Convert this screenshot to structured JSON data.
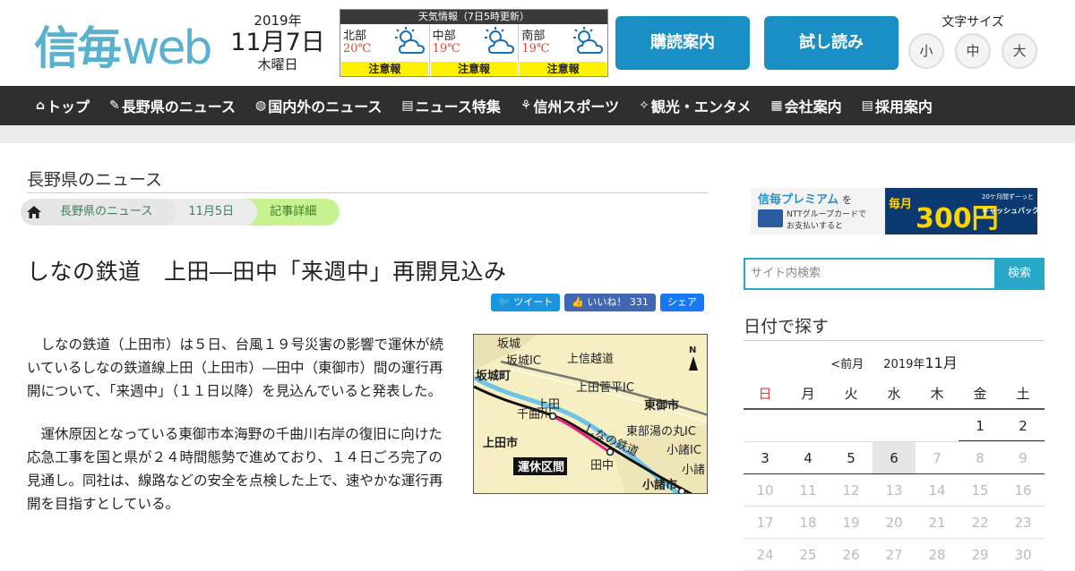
{
  "header": {
    "logo_kanji": "信毎",
    "logo_web": "web",
    "date_year": "2019年",
    "date_md": "11月7日",
    "date_weekday": "木曜日",
    "weather": {
      "title": "天気情報（7日5時更新）",
      "regions": [
        {
          "name": "北部",
          "temp": "20℃",
          "warning": "注意報",
          "icon": "sun-cloud-icon"
        },
        {
          "name": "中部",
          "temp": "19℃",
          "warning": "注意報",
          "icon": "sun-cloud-icon"
        },
        {
          "name": "南部",
          "temp": "19℃",
          "warning": "注意報",
          "icon": "sun-cloud-icon"
        }
      ]
    },
    "subscribe_label": "購読案内",
    "trial_label": "試し読み",
    "fontsize": {
      "label": "文字サイズ",
      "small": "小",
      "medium": "中",
      "large": "大"
    }
  },
  "nav": [
    {
      "icon": "home-icon",
      "glyph": "⌂",
      "label": "トップ"
    },
    {
      "icon": "bolt-icon",
      "glyph": "✎",
      "label": "長野県のニュース"
    },
    {
      "icon": "globe-icon",
      "glyph": "◍",
      "label": "国内外のニュース"
    },
    {
      "icon": "document-icon",
      "glyph": "▤",
      "label": "ニュース特集"
    },
    {
      "icon": "sports-icon",
      "glyph": "⚘",
      "label": "信州スポーツ"
    },
    {
      "icon": "camera-icon",
      "glyph": "✧",
      "label": "観光・エンタメ"
    },
    {
      "icon": "building-icon",
      "glyph": "▦",
      "label": "会社案内"
    },
    {
      "icon": "list-icon",
      "glyph": "▤",
      "label": "採用案内"
    }
  ],
  "article": {
    "category": "長野県のニュース",
    "breadcrumbs": [
      "長野県のニュース",
      "11月5日",
      "記事詳細"
    ],
    "headline": "しなの鉄道　上田―田中「来週中」再開見込み",
    "share": {
      "tweet": "ツイート",
      "like": "いいね！ 331",
      "share": "シェア"
    },
    "paragraphs": [
      "しなの鉄道（上田市）は５日、台風１９号災害の影響で運休が続いているしなの鉄道線上田（上田市）―田中（東御市）間の運行再開について、「来週中」（１１日以降）を見込んでいると発表した。",
      "運休原因となっている東御市本海野の千曲川右岸の復旧に向けた応急工事を国と県が２４時間態勢で進めており、１４日ごろ完了の見通し。同社は、線路などの安全を点検した上で、速やかな運行再開を目指すとしている。"
    ],
    "map_labels": {
      "sakaki": "坂城",
      "sakaki_ic": "坂城IC",
      "joshin": "上信越道",
      "sakaki_town": "坂城町",
      "ueda": "上田",
      "ueda_sugadaira": "上田菅平IC",
      "tomi": "東御市",
      "chikuma": "千曲川",
      "tobu": "東部湯の丸IC",
      "shinano": "しなの鉄道",
      "ueda_city": "上田市",
      "komoro_ic": "小諸IC",
      "suspended": "運休区間",
      "tanaka": "田中",
      "komoro": "小諸",
      "komoro_city": "小諸市",
      "north": "N"
    }
  },
  "sidebar": {
    "ad": {
      "brand": "信毎プレミアム",
      "suffix": "を",
      "line1": "NTTグループカードで",
      "line2": "お支払いすると",
      "maitsuki": "毎月",
      "amount": "300円",
      "cashback": "キャッシュバック!!",
      "period": "20ケ月間ずーっと"
    },
    "search_placeholder": "サイト内検索",
    "search_button": "検索",
    "date_title": "日付で探す",
    "cal_prev": "<前月",
    "cal_year": "2019年",
    "cal_month": "11月",
    "weekdays": [
      "日",
      "月",
      "火",
      "水",
      "木",
      "金",
      "土"
    ],
    "weeks": [
      [
        "",
        "",
        "",
        "",
        "",
        "1",
        "2"
      ],
      [
        "3",
        "4",
        "5",
        "6",
        "7",
        "8",
        "9"
      ],
      [
        "10",
        "11",
        "12",
        "13",
        "14",
        "15",
        "16"
      ],
      [
        "17",
        "18",
        "19",
        "20",
        "21",
        "22",
        "23"
      ],
      [
        "24",
        "25",
        "26",
        "27",
        "28",
        "29",
        "30"
      ]
    ]
  },
  "colors": {
    "brand": "#5ab0cf",
    "button": "#1a8fc6",
    "nav": "#2f2f2f",
    "search": "#29a7c9",
    "warning": "#fff200",
    "sunday": "#e23b3b"
  }
}
